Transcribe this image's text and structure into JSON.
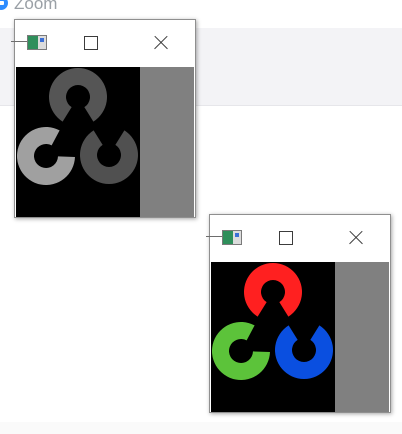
{
  "background_app": {
    "title": "Zoom",
    "logo_color": "#2d8cff"
  },
  "windows": [
    {
      "id": "grayscale",
      "title_icon": "opencv-app-icon",
      "buttons": [
        "maximize-icon",
        "close-icon"
      ],
      "image": "opencv-logo-grayscale",
      "pad_color": "#808080",
      "ring_colors": {
        "top": "#555555",
        "left": "#a0a0a0",
        "right": "#505050"
      }
    },
    {
      "id": "color",
      "title_icon": "opencv-app-icon",
      "buttons": [
        "maximize-icon",
        "close-icon"
      ],
      "image": "opencv-logo-color",
      "pad_color": "#808080",
      "ring_colors": {
        "top": "#ff2020",
        "left": "#5cc33a",
        "right": "#0a4fe0"
      }
    }
  ]
}
